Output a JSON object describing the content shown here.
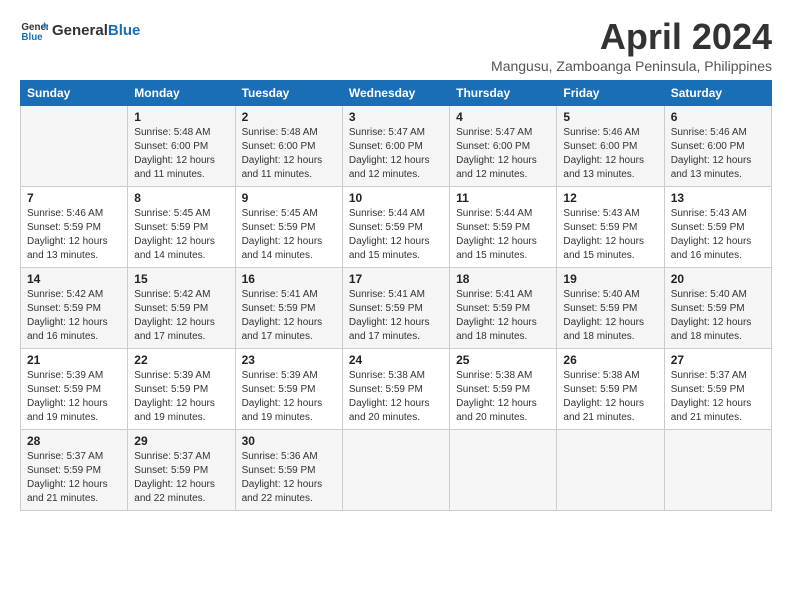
{
  "header": {
    "logo_general": "General",
    "logo_blue": "Blue",
    "month": "April 2024",
    "location": "Mangusu, Zamboanga Peninsula, Philippines"
  },
  "days_of_week": [
    "Sunday",
    "Monday",
    "Tuesday",
    "Wednesday",
    "Thursday",
    "Friday",
    "Saturday"
  ],
  "weeks": [
    [
      {
        "day": "",
        "sunrise": "",
        "sunset": "",
        "daylight": ""
      },
      {
        "day": "1",
        "sunrise": "Sunrise: 5:48 AM",
        "sunset": "Sunset: 6:00 PM",
        "daylight": "Daylight: 12 hours and 11 minutes."
      },
      {
        "day": "2",
        "sunrise": "Sunrise: 5:48 AM",
        "sunset": "Sunset: 6:00 PM",
        "daylight": "Daylight: 12 hours and 11 minutes."
      },
      {
        "day": "3",
        "sunrise": "Sunrise: 5:47 AM",
        "sunset": "Sunset: 6:00 PM",
        "daylight": "Daylight: 12 hours and 12 minutes."
      },
      {
        "day": "4",
        "sunrise": "Sunrise: 5:47 AM",
        "sunset": "Sunset: 6:00 PM",
        "daylight": "Daylight: 12 hours and 12 minutes."
      },
      {
        "day": "5",
        "sunrise": "Sunrise: 5:46 AM",
        "sunset": "Sunset: 6:00 PM",
        "daylight": "Daylight: 12 hours and 13 minutes."
      },
      {
        "day": "6",
        "sunrise": "Sunrise: 5:46 AM",
        "sunset": "Sunset: 6:00 PM",
        "daylight": "Daylight: 12 hours and 13 minutes."
      }
    ],
    [
      {
        "day": "7",
        "sunrise": "Sunrise: 5:46 AM",
        "sunset": "Sunset: 5:59 PM",
        "daylight": "Daylight: 12 hours and 13 minutes."
      },
      {
        "day": "8",
        "sunrise": "Sunrise: 5:45 AM",
        "sunset": "Sunset: 5:59 PM",
        "daylight": "Daylight: 12 hours and 14 minutes."
      },
      {
        "day": "9",
        "sunrise": "Sunrise: 5:45 AM",
        "sunset": "Sunset: 5:59 PM",
        "daylight": "Daylight: 12 hours and 14 minutes."
      },
      {
        "day": "10",
        "sunrise": "Sunrise: 5:44 AM",
        "sunset": "Sunset: 5:59 PM",
        "daylight": "Daylight: 12 hours and 15 minutes."
      },
      {
        "day": "11",
        "sunrise": "Sunrise: 5:44 AM",
        "sunset": "Sunset: 5:59 PM",
        "daylight": "Daylight: 12 hours and 15 minutes."
      },
      {
        "day": "12",
        "sunrise": "Sunrise: 5:43 AM",
        "sunset": "Sunset: 5:59 PM",
        "daylight": "Daylight: 12 hours and 15 minutes."
      },
      {
        "day": "13",
        "sunrise": "Sunrise: 5:43 AM",
        "sunset": "Sunset: 5:59 PM",
        "daylight": "Daylight: 12 hours and 16 minutes."
      }
    ],
    [
      {
        "day": "14",
        "sunrise": "Sunrise: 5:42 AM",
        "sunset": "Sunset: 5:59 PM",
        "daylight": "Daylight: 12 hours and 16 minutes."
      },
      {
        "day": "15",
        "sunrise": "Sunrise: 5:42 AM",
        "sunset": "Sunset: 5:59 PM",
        "daylight": "Daylight: 12 hours and 17 minutes."
      },
      {
        "day": "16",
        "sunrise": "Sunrise: 5:41 AM",
        "sunset": "Sunset: 5:59 PM",
        "daylight": "Daylight: 12 hours and 17 minutes."
      },
      {
        "day": "17",
        "sunrise": "Sunrise: 5:41 AM",
        "sunset": "Sunset: 5:59 PM",
        "daylight": "Daylight: 12 hours and 17 minutes."
      },
      {
        "day": "18",
        "sunrise": "Sunrise: 5:41 AM",
        "sunset": "Sunset: 5:59 PM",
        "daylight": "Daylight: 12 hours and 18 minutes."
      },
      {
        "day": "19",
        "sunrise": "Sunrise: 5:40 AM",
        "sunset": "Sunset: 5:59 PM",
        "daylight": "Daylight: 12 hours and 18 minutes."
      },
      {
        "day": "20",
        "sunrise": "Sunrise: 5:40 AM",
        "sunset": "Sunset: 5:59 PM",
        "daylight": "Daylight: 12 hours and 18 minutes."
      }
    ],
    [
      {
        "day": "21",
        "sunrise": "Sunrise: 5:39 AM",
        "sunset": "Sunset: 5:59 PM",
        "daylight": "Daylight: 12 hours and 19 minutes."
      },
      {
        "day": "22",
        "sunrise": "Sunrise: 5:39 AM",
        "sunset": "Sunset: 5:59 PM",
        "daylight": "Daylight: 12 hours and 19 minutes."
      },
      {
        "day": "23",
        "sunrise": "Sunrise: 5:39 AM",
        "sunset": "Sunset: 5:59 PM",
        "daylight": "Daylight: 12 hours and 19 minutes."
      },
      {
        "day": "24",
        "sunrise": "Sunrise: 5:38 AM",
        "sunset": "Sunset: 5:59 PM",
        "daylight": "Daylight: 12 hours and 20 minutes."
      },
      {
        "day": "25",
        "sunrise": "Sunrise: 5:38 AM",
        "sunset": "Sunset: 5:59 PM",
        "daylight": "Daylight: 12 hours and 20 minutes."
      },
      {
        "day": "26",
        "sunrise": "Sunrise: 5:38 AM",
        "sunset": "Sunset: 5:59 PM",
        "daylight": "Daylight: 12 hours and 21 minutes."
      },
      {
        "day": "27",
        "sunrise": "Sunrise: 5:37 AM",
        "sunset": "Sunset: 5:59 PM",
        "daylight": "Daylight: 12 hours and 21 minutes."
      }
    ],
    [
      {
        "day": "28",
        "sunrise": "Sunrise: 5:37 AM",
        "sunset": "Sunset: 5:59 PM",
        "daylight": "Daylight: 12 hours and 21 minutes."
      },
      {
        "day": "29",
        "sunrise": "Sunrise: 5:37 AM",
        "sunset": "Sunset: 5:59 PM",
        "daylight": "Daylight: 12 hours and 22 minutes."
      },
      {
        "day": "30",
        "sunrise": "Sunrise: 5:36 AM",
        "sunset": "Sunset: 5:59 PM",
        "daylight": "Daylight: 12 hours and 22 minutes."
      },
      {
        "day": "",
        "sunrise": "",
        "sunset": "",
        "daylight": ""
      },
      {
        "day": "",
        "sunrise": "",
        "sunset": "",
        "daylight": ""
      },
      {
        "day": "",
        "sunrise": "",
        "sunset": "",
        "daylight": ""
      },
      {
        "day": "",
        "sunrise": "",
        "sunset": "",
        "daylight": ""
      }
    ]
  ]
}
